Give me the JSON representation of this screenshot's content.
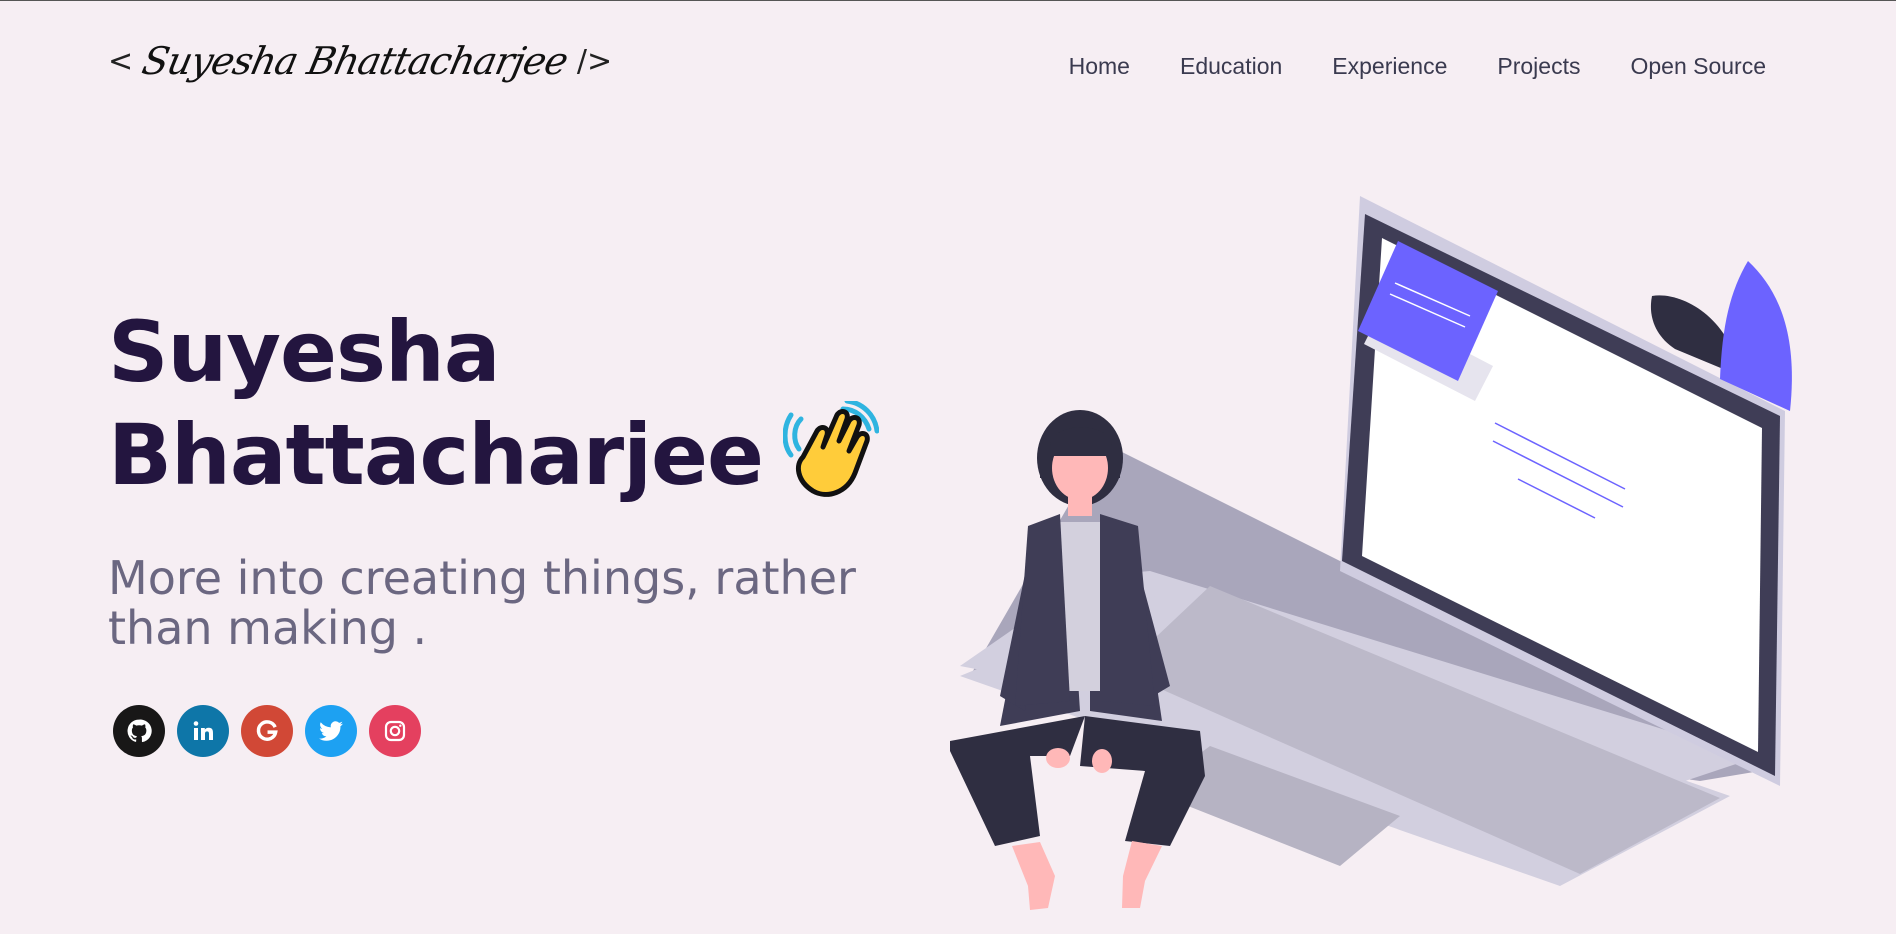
{
  "header": {
    "logo_open": "<",
    "logo_name": "Suyesha Bhattacharjee",
    "logo_close": "/>"
  },
  "nav": {
    "items": [
      {
        "label": "Home"
      },
      {
        "label": "Education"
      },
      {
        "label": "Experience"
      },
      {
        "label": "Projects"
      },
      {
        "label": "Open Source"
      }
    ]
  },
  "hero": {
    "name_line1": "Suyesha",
    "name_line2": "Bhattacharjee",
    "wave_emoji_icon": "waving-hand-icon",
    "subtitle": "More into creating things, rather than making ."
  },
  "socials": [
    {
      "name": "github",
      "icon": "github-icon",
      "color": "#181717"
    },
    {
      "name": "linkedin",
      "icon": "linkedin-icon",
      "color": "#0e76a8"
    },
    {
      "name": "google",
      "icon": "google-icon",
      "color": "#d14836"
    },
    {
      "name": "twitter",
      "icon": "twitter-icon",
      "color": "#1da1f2"
    },
    {
      "name": "instagram",
      "icon": "instagram-icon",
      "color": "#e4405f"
    }
  ],
  "colors": {
    "background": "#f6eef3",
    "title": "#23153f",
    "subtitle": "#6b6781",
    "accent": "#6c63ff"
  }
}
